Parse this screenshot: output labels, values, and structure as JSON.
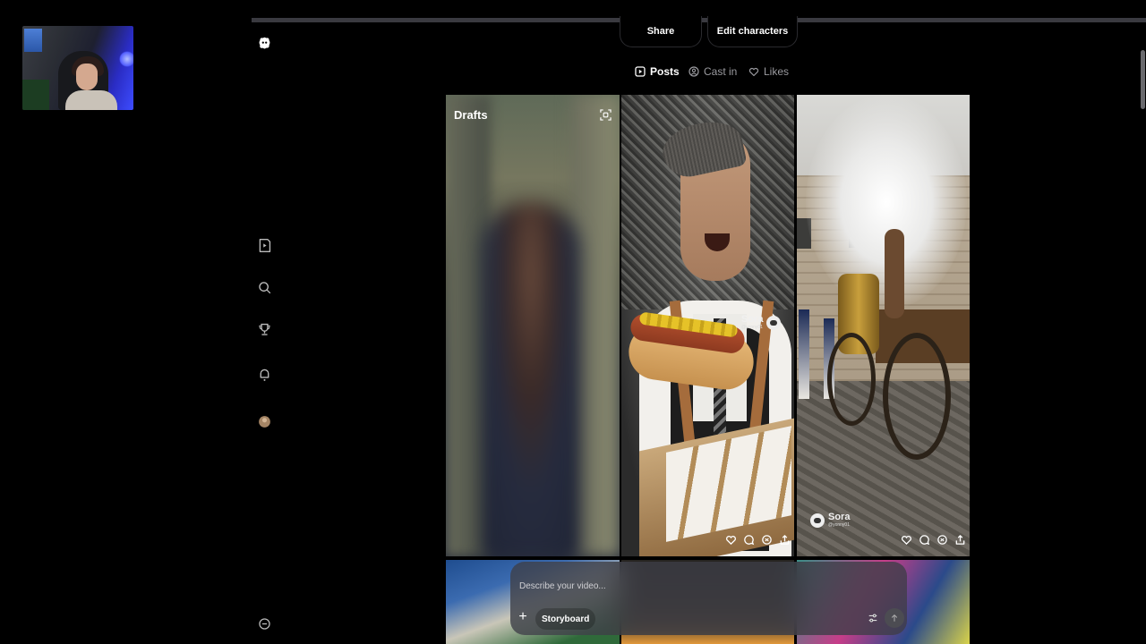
{
  "header": {
    "share_label": "Share",
    "edit_characters_label": "Edit characters"
  },
  "tabs": [
    {
      "label": "Posts",
      "icon": "play-square-icon",
      "active": true
    },
    {
      "label": "Cast in",
      "icon": "person-circle-icon",
      "active": false
    },
    {
      "label": "Likes",
      "icon": "heart-icon",
      "active": false
    }
  ],
  "sidebar": {
    "items": [
      {
        "icon": "sora-logo-icon"
      },
      {
        "icon": "play-icon"
      },
      {
        "icon": "search-icon"
      },
      {
        "icon": "trophy-icon"
      },
      {
        "icon": "bell-icon"
      },
      {
        "icon": "avatar"
      },
      {
        "icon": "more-icon"
      }
    ]
  },
  "grid": {
    "drafts_label": "Drafts",
    "watermark": {
      "brand": "Sora",
      "handle": "@yonny01"
    }
  },
  "composer": {
    "placeholder": "Describe your video...",
    "storyboard_label": "Storyboard",
    "plus_label": "+"
  },
  "colors": {
    "background": "#000000",
    "prompt_bg": "#3c3e46",
    "muted_text": "#9a9a9f"
  }
}
